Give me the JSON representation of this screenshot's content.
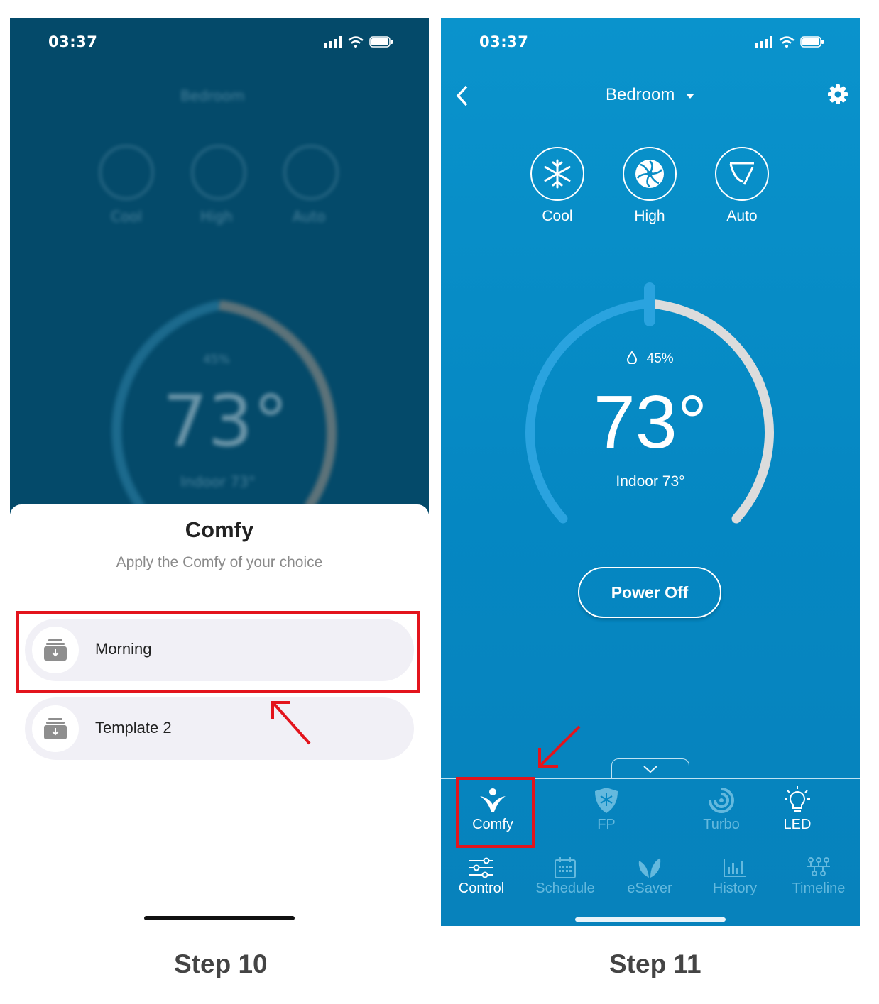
{
  "left_screen": {
    "status_time": "03:37",
    "blurred": {
      "nav_title": "Bedroom",
      "modes": [
        "Cool",
        "High",
        "Auto"
      ],
      "humidity": "45%",
      "temperature": "73°",
      "indoor": "Indoor 73°"
    },
    "sheet": {
      "title": "Comfy",
      "subtitle": "Apply the Comfy of your choice",
      "options": [
        {
          "label": "Morning",
          "icon": "comfy-template-icon"
        },
        {
          "label": "Template 2",
          "icon": "comfy-template-icon"
        }
      ]
    }
  },
  "right_screen": {
    "status_time": "03:37",
    "nav": {
      "title": "Bedroom",
      "back_icon": "chevron-left-icon",
      "settings_icon": "gear-icon"
    },
    "modes": [
      {
        "label": "Cool",
        "icon": "snowflake-icon"
      },
      {
        "label": "High",
        "icon": "fan-icon"
      },
      {
        "label": "Auto",
        "icon": "swing-icon"
      }
    ],
    "dial": {
      "humidity": "45%",
      "temperature": "73°",
      "indoor": "Indoor 73°"
    },
    "power_button": "Power Off",
    "features": [
      {
        "label": "Comfy",
        "icon": "comfy-person-icon"
      },
      {
        "label": "FP",
        "icon": "frost-protection-icon"
      },
      {
        "label": "Turbo",
        "icon": "turbo-swirl-icon"
      },
      {
        "label": "LED",
        "icon": "lightbulb-icon"
      }
    ],
    "tabbar": [
      {
        "label": "Control",
        "icon": "sliders-icon"
      },
      {
        "label": "Schedule",
        "icon": "calendar-icon"
      },
      {
        "label": "eSaver",
        "icon": "leaf-icon"
      },
      {
        "label": "History",
        "icon": "bar-chart-icon"
      },
      {
        "label": "Timeline",
        "icon": "timeline-icon"
      }
    ]
  },
  "captions": {
    "left": "Step 10",
    "right": "Step 11"
  },
  "colors": {
    "highlight_red": "#e3141c",
    "app_blue": "#0587c2",
    "blur_dark": "#044a6a"
  }
}
